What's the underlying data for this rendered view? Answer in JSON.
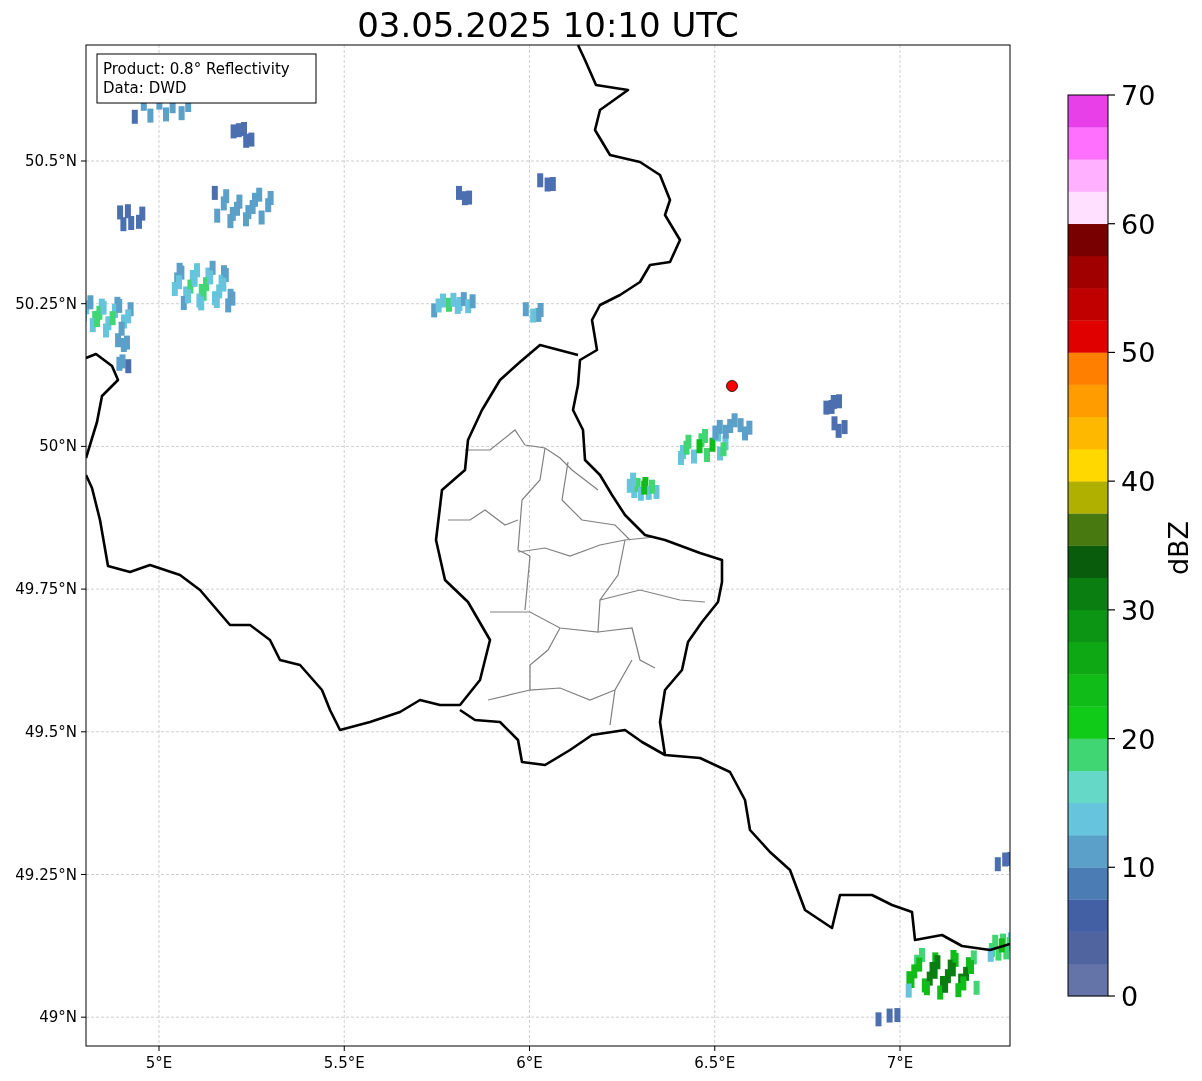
{
  "title": "03.05.2025 10:10 UTC",
  "info_box": [
    "Product: 0.8° Reflectivity",
    "Data: DWD"
  ],
  "x_ticks": [
    "5°E",
    "5.5°E",
    "6°E",
    "6.5°E",
    "7°E"
  ],
  "y_ticks": [
    "50.5°N",
    "50.25°N",
    "50°N",
    "49.75°N",
    "49.5°N",
    "49.25°N",
    "49°N"
  ],
  "colorbar": {
    "label": "dBZ",
    "ticks": [
      "70",
      "60",
      "50",
      "40",
      "30",
      "20",
      "10",
      "0"
    ],
    "bands": [
      {
        "color": "#6474a8"
      },
      {
        "color": "#5065a0"
      },
      {
        "color": "#4460a4"
      },
      {
        "color": "#4c7cb4"
      },
      {
        "color": "#5aa0c8"
      },
      {
        "color": "#66c4dc"
      },
      {
        "color": "#66d8c8"
      },
      {
        "color": "#40d674"
      },
      {
        "color": "#10cc18"
      },
      {
        "color": "#10bc18"
      },
      {
        "color": "#0ea814"
      },
      {
        "color": "#0c9414"
      },
      {
        "color": "#0b7e12"
      },
      {
        "color": "#085c0c"
      },
      {
        "color": "#487810"
      },
      {
        "color": "#b0b000"
      },
      {
        "color": "#ffd800"
      },
      {
        "color": "#ffb800"
      },
      {
        "color": "#ff9c00"
      },
      {
        "color": "#ff8000"
      },
      {
        "color": "#e00000"
      },
      {
        "color": "#c00000"
      },
      {
        "color": "#a00000"
      },
      {
        "color": "#780000"
      },
      {
        "color": "#ffe0ff"
      },
      {
        "color": "#ffb0ff"
      },
      {
        "color": "#ff70ff"
      },
      {
        "color": "#e840e8"
      }
    ]
  }
}
